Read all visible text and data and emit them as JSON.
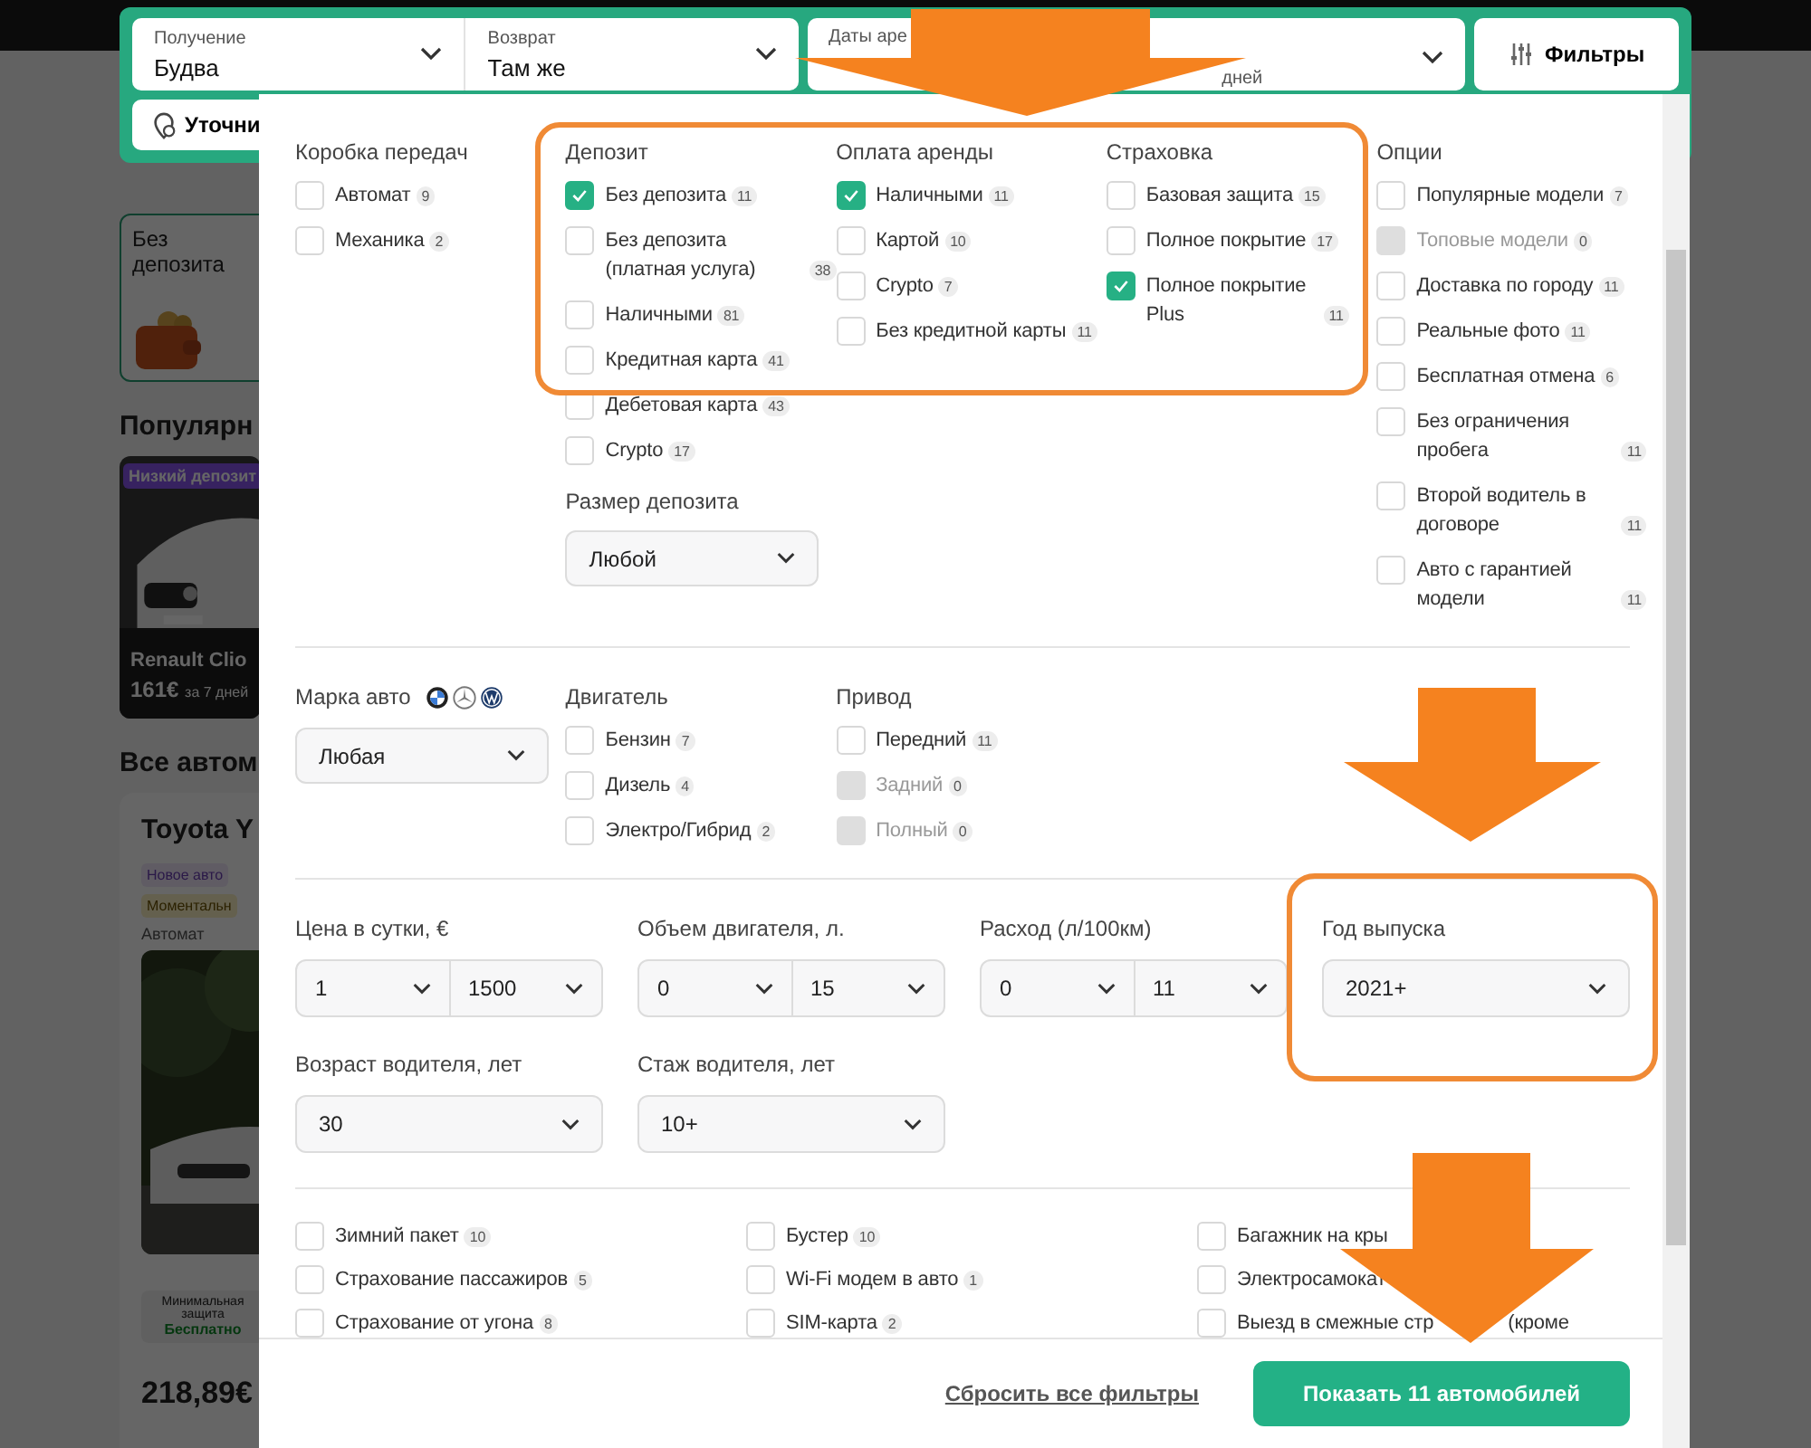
{
  "search_bar": {
    "fields": [
      {
        "label": "Получение",
        "value": "Будва"
      },
      {
        "label": "Возврат",
        "value": "Там же"
      },
      {
        "label": "Даты аре",
        "value": "дней"
      }
    ],
    "filters_button": "Фильтры",
    "refine_button": "Уточни"
  },
  "background": {
    "promo_card": "Без депозита",
    "popular_heading": "Популярн",
    "popular_car": {
      "badge": "Низкий депозит",
      "name": "Renault Clio",
      "price": "161€",
      "period": "за 7 дней"
    },
    "all_heading": "Все автом",
    "car_card": {
      "name": "Toyota Y",
      "tags": [
        "Новое авто",
        "Моментальн"
      ],
      "transmission": "Автомат",
      "insurance": "Минимальная защита",
      "insurance_price": "Бесплатно",
      "price": "218,89€"
    }
  },
  "filters": {
    "groups": [
      {
        "title": "Коробка передач",
        "items": [
          {
            "label": "Автомат",
            "count": "9",
            "checked": false,
            "disabled": false
          },
          {
            "label": "Механика",
            "count": "2",
            "checked": false,
            "disabled": false
          }
        ]
      },
      {
        "title": "Депозит",
        "items": [
          {
            "label": "Без депозита",
            "count": "11",
            "checked": true,
            "disabled": false
          },
          {
            "label": "Без депозита (платная услуга)",
            "count": "38",
            "checked": false,
            "disabled": false
          },
          {
            "label": "Наличными",
            "count": "81",
            "checked": false,
            "disabled": false
          },
          {
            "label": "Кредитная карта",
            "count": "41",
            "checked": false,
            "disabled": false
          },
          {
            "label": "Дебетовая карта",
            "count": "43",
            "checked": false,
            "disabled": false
          },
          {
            "label": "Crypto",
            "count": "17",
            "checked": false,
            "disabled": false
          }
        ],
        "select": {
          "label": "Размер депозита",
          "value": "Любой"
        }
      },
      {
        "title": "Оплата аренды",
        "items": [
          {
            "label": "Наличными",
            "count": "11",
            "checked": true,
            "disabled": false
          },
          {
            "label": "Картой",
            "count": "10",
            "checked": false,
            "disabled": false
          },
          {
            "label": "Crypto",
            "count": "7",
            "checked": false,
            "disabled": false
          },
          {
            "label": "Без кредитной карты",
            "count": "11",
            "checked": false,
            "disabled": false
          }
        ]
      },
      {
        "title": "Страховка",
        "items": [
          {
            "label": "Базовая защита",
            "count": "15",
            "checked": false,
            "disabled": false
          },
          {
            "label": "Полное покрытие",
            "count": "17",
            "checked": false,
            "disabled": false
          },
          {
            "label": "Полное покрытие Plus",
            "count": "11",
            "checked": true,
            "disabled": false
          }
        ]
      },
      {
        "title": "Опции",
        "items": [
          {
            "label": "Популярные модели",
            "count": "7",
            "checked": false,
            "disabled": false
          },
          {
            "label": "Топовые модели",
            "count": "0",
            "checked": false,
            "disabled": true
          },
          {
            "label": "Доставка по городу",
            "count": "11",
            "checked": false,
            "disabled": false
          },
          {
            "label": "Реальные фото",
            "count": "11",
            "checked": false,
            "disabled": false
          },
          {
            "label": "Бесплатная отмена",
            "count": "6",
            "checked": false,
            "disabled": false
          },
          {
            "label": "Без ограничения пробега",
            "count": "11",
            "checked": false,
            "disabled": false
          },
          {
            "label": "Второй водитель в договоре",
            "count": "11",
            "checked": false,
            "disabled": false
          },
          {
            "label": "Авто с гарантией модели",
            "count": "11",
            "checked": false,
            "disabled": false
          }
        ]
      }
    ],
    "brand": {
      "label": "Марка авто",
      "value": "Любая"
    },
    "engine_groups": [
      {
        "title": "Двигатель",
        "items": [
          {
            "label": "Бензин",
            "count": "7",
            "checked": false,
            "disabled": false
          },
          {
            "label": "Дизель",
            "count": "4",
            "checked": false,
            "disabled": false
          },
          {
            "label": "Электро/Гибрид",
            "count": "2",
            "checked": false,
            "disabled": false
          }
        ]
      },
      {
        "title": "Привод",
        "items": [
          {
            "label": "Передний",
            "count": "11",
            "checked": false,
            "disabled": false
          },
          {
            "label": "Задний",
            "count": "0",
            "checked": false,
            "disabled": true
          },
          {
            "label": "Полный",
            "count": "0",
            "checked": false,
            "disabled": true
          }
        ]
      }
    ],
    "ranges": [
      {
        "label": "Цена в сутки, €",
        "kind": "range",
        "values": [
          "1",
          "1500"
        ]
      },
      {
        "label": "Объем двигателя, л.",
        "kind": "range",
        "values": [
          "0",
          "15"
        ]
      },
      {
        "label": "Расход (л/100км)",
        "kind": "range",
        "values": [
          "0",
          "11"
        ]
      },
      {
        "label": "Год выпуска",
        "kind": "single",
        "values": [
          "2021+"
        ]
      },
      {
        "label": "Возраст водителя, лет",
        "kind": "single",
        "values": [
          "30"
        ]
      },
      {
        "label": "Стаж водителя, лет",
        "kind": "single",
        "values": [
          "10+"
        ]
      }
    ],
    "extras": [
      {
        "items": [
          {
            "label": "Зимний пакет",
            "count": "10",
            "checked": false,
            "disabled": false
          },
          {
            "label": "Страхование пассажиров",
            "count": "5",
            "checked": false,
            "disabled": false
          },
          {
            "label": "Страхование от угона",
            "count": "8",
            "checked": false,
            "disabled": false
          }
        ]
      },
      {
        "items": [
          {
            "label": "Бустер",
            "count": "10",
            "checked": false,
            "disabled": false
          },
          {
            "label": "Wi-Fi модем в авто",
            "count": "1",
            "checked": false,
            "disabled": false
          },
          {
            "label": "SIM-карта",
            "count": "2",
            "checked": false,
            "disabled": false
          }
        ]
      },
      {
        "items": [
          {
            "label": "Багажник на кры",
            "checked": false,
            "disabled": false
          },
          {
            "label": "Электросамокат",
            "checked": false,
            "disabled": false
          },
          {
            "label": "Выезд в смежные стр",
            "label_tail": "(кроме",
            "checked": false,
            "disabled": false
          }
        ]
      }
    ]
  },
  "footer": {
    "reset_link": "Сбросить все фильтры",
    "show_button": "Показать 11 автомобилей"
  }
}
